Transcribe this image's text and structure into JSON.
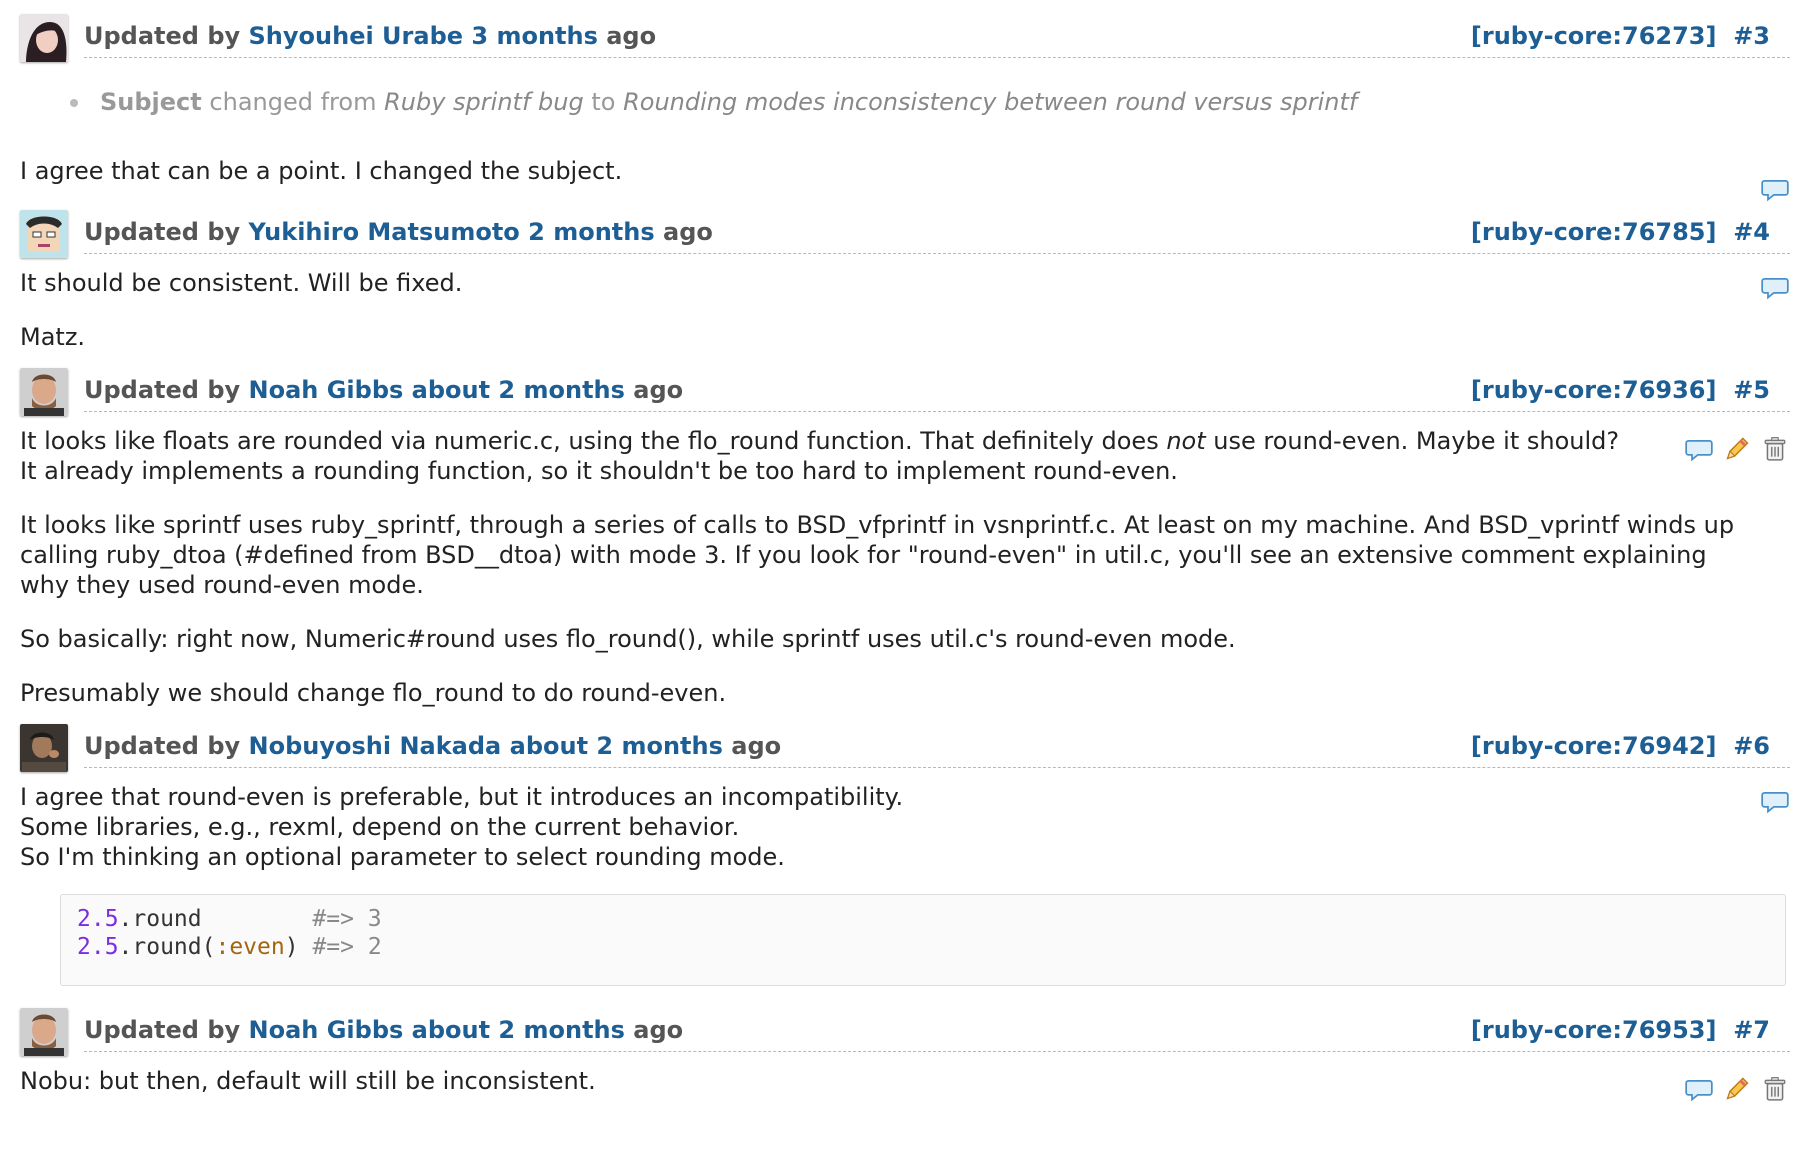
{
  "labels": {
    "updated_by": "Updated by",
    "ago": "ago"
  },
  "colors": {
    "link": "#1d5e95",
    "code_number": "#7a2ee0",
    "code_symbol": "#a3660c"
  },
  "entries": [
    {
      "author": "Shyouhei Urabe",
      "time": "3 months",
      "ref": "[ruby-core:76273]",
      "num": "#3",
      "detail": {
        "field": "Subject",
        "changed_from": "changed from",
        "old": "Ruby sprintf bug",
        "to": "to",
        "new": "Rounding modes inconsistency between round versus sprintf"
      },
      "paragraphs": [
        "I agree that can be a point. I changed the subject."
      ]
    },
    {
      "author": "Yukihiro Matsumoto",
      "time": "2 months",
      "ref": "[ruby-core:76785]",
      "num": "#4",
      "paragraphs": [
        "It should be consistent. Will be fixed.",
        "Matz."
      ]
    },
    {
      "author": "Noah Gibbs",
      "time": "about 2 months",
      "ref": "[ruby-core:76936]",
      "num": "#5",
      "p1_a": "It looks like floats are rounded via numeric.c, using the flo_round function. That definitely does ",
      "p1_em": "not",
      "p1_b": " use round-even. Maybe it should?",
      "p1_line2": "It already implements a rounding function, so it shouldn't be too hard to implement round-even.",
      "p2_line1": "It looks like sprintf uses ruby_sprintf, through a series of calls to BSD_vfprintf in vsnprintf.c. At least on my machine. And BSD_vprintf winds up",
      "p2_line2": "calling ruby_dtoa (#defined from BSD__dtoa) with mode 3. If you look for \"round-even\" in util.c, you'll see an extensive comment explaining",
      "p2_line3": "why they used round-even mode.",
      "p3": "So basically: right now, Numeric#round uses flo_round(), while sprintf uses util.c's round-even mode.",
      "p4": "Presumably we should change flo_round to do round-even."
    },
    {
      "author": "Nobuyoshi Nakada",
      "time": "about 2 months",
      "ref": "[ruby-core:76942]",
      "num": "#6",
      "lines": [
        "I agree that round-even is preferable, but it introduces an incompatibility.",
        "Some libraries, e.g., rexml, depend on the current behavior.",
        "So I'm thinking an optional parameter to select rounding mode."
      ],
      "code": {
        "l1_num": "2.5",
        "l1_call": ".round        ",
        "l1_comment": "#=> 3",
        "l2_num": "2.5",
        "l2_call": ".round(",
        "l2_sym": ":even",
        "l2_close": ") ",
        "l2_comment": "#=> 2"
      }
    },
    {
      "author": "Noah Gibbs",
      "time": "about 2 months",
      "ref": "[ruby-core:76953]",
      "num": "#7",
      "paragraphs": [
        "Nobu: but then, default will still be inconsistent."
      ]
    }
  ]
}
